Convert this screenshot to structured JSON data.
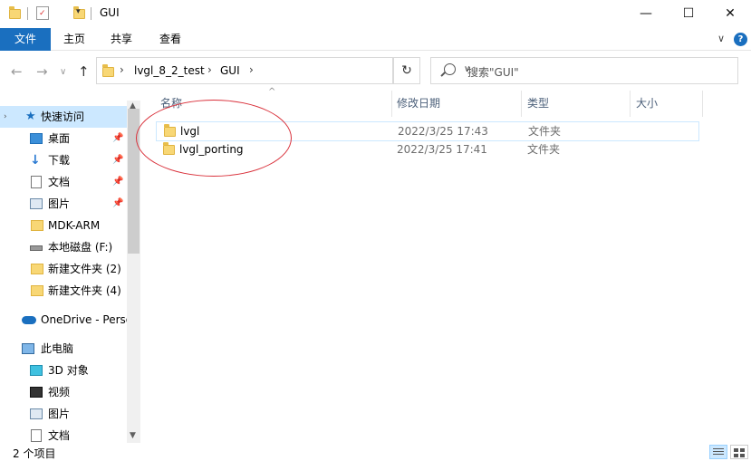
{
  "window": {
    "title": "GUI",
    "minimize": "—",
    "maximize": "☐",
    "close": "✕"
  },
  "ribbon": {
    "tabs": [
      "文件",
      "主页",
      "共享",
      "查看"
    ],
    "expand": "∨",
    "help": "?"
  },
  "nav": {
    "back": "←",
    "forward": "→",
    "recent": "∨",
    "up": "↑",
    "refresh": "↻"
  },
  "address": {
    "crumbs": [
      "lvgl_8_2_test",
      "GUI"
    ],
    "dropdown": "∨"
  },
  "search": {
    "placeholder": "搜索\"GUI\""
  },
  "sidebar": {
    "items": [
      {
        "label": "快速访问",
        "icon": "star-icon"
      },
      {
        "label": "桌面",
        "icon": "desktop-icon",
        "pinned": true
      },
      {
        "label": "下载",
        "icon": "download-icon",
        "pinned": true
      },
      {
        "label": "文档",
        "icon": "document-icon",
        "pinned": true
      },
      {
        "label": "图片",
        "icon": "picture-icon",
        "pinned": true
      },
      {
        "label": "MDK-ARM",
        "icon": "folder-icon"
      },
      {
        "label": "本地磁盘 (F:)",
        "icon": "drive-icon"
      },
      {
        "label": "新建文件夹 (2)",
        "icon": "folder-icon"
      },
      {
        "label": "新建文件夹 (4)",
        "icon": "folder-icon"
      },
      {
        "label": "OneDrive - Perso",
        "icon": "cloud-icon"
      },
      {
        "label": "此电脑",
        "icon": "computer-icon"
      },
      {
        "label": "3D 对象",
        "icon": "cube-icon"
      },
      {
        "label": "视频",
        "icon": "video-icon"
      },
      {
        "label": "图片",
        "icon": "picture-icon"
      },
      {
        "label": "文档",
        "icon": "document-icon"
      }
    ]
  },
  "columns": {
    "name": "名称",
    "date": "修改日期",
    "type": "类型",
    "size": "大小"
  },
  "files": [
    {
      "name": "lvgl",
      "date": "2022/3/25 17:43",
      "type": "文件夹"
    },
    {
      "name": "lvgl_porting",
      "date": "2022/3/25 17:41",
      "type": "文件夹"
    }
  ],
  "status": {
    "count": "2 个项目"
  },
  "colors": {
    "accent": "#1a6fbf",
    "selection": "#cce8ff",
    "annotation": "#d9303a"
  }
}
